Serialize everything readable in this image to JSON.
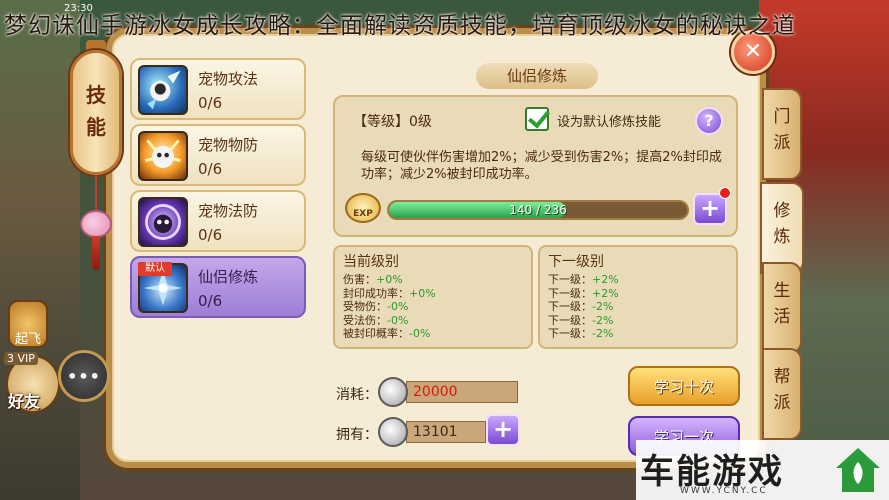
{
  "article_title": "梦幻诛仙手游冰女成长攻略：全面解读资质技能，培育顶级冰女的秘诀之道",
  "clock": "23:30",
  "lantern": {
    "label": "技能"
  },
  "hud": {
    "fly_label": "起飞",
    "friend_label": "好友",
    "vip_label": "3 VIP",
    "chat_icon": "chat-bubble-icon"
  },
  "panel": {
    "title": "仙侣修炼",
    "close_icon": "close-icon"
  },
  "skills": [
    {
      "name": "宠物攻法",
      "progress": "0/6",
      "icon": "pet-attack-icon",
      "selected": false
    },
    {
      "name": "宠物物防",
      "progress": "0/6",
      "icon": "pet-defense-icon",
      "selected": false
    },
    {
      "name": "宠物法防",
      "progress": "0/6",
      "icon": "pet-magic-defense-icon",
      "selected": false
    },
    {
      "name": "仙侣修炼",
      "progress": "0/6",
      "icon": "partner-cultivation-icon",
      "selected": true,
      "tag": "默认"
    }
  ],
  "level": {
    "label": "【等级】0级",
    "default_checkbox_label": "设为默认修炼技能",
    "default_checked": true,
    "description": "每级可使伙伴伤害增加2%；减少受到伤害2%；提高2%封印成功率；减少2%被封印成功率。",
    "exp_badge": "EXP",
    "exp_current": 140,
    "exp_max": 236,
    "exp_text": "140 / 236"
  },
  "current_level": {
    "title": "当前级别",
    "rows": [
      {
        "label": "伤害：",
        "value": "+0%"
      },
      {
        "label": "封印成功率：",
        "value": "+0%"
      },
      {
        "label": "受物伤：",
        "value": "-0%"
      },
      {
        "label": "受法伤：",
        "value": "-0%"
      },
      {
        "label": "被封印概率：",
        "value": "-0%"
      }
    ]
  },
  "next_level": {
    "title": "下一级别",
    "rows": [
      {
        "label": "下一级：",
        "value": "+2%"
      },
      {
        "label": "下一级：",
        "value": "+2%"
      },
      {
        "label": "下一级：",
        "value": "-2%"
      },
      {
        "label": "下一级：",
        "value": "-2%"
      },
      {
        "label": "下一级：",
        "value": "-2%"
      }
    ]
  },
  "cost": {
    "label": "消耗：",
    "value": "20000"
  },
  "owned": {
    "label": "拥有：",
    "value": "13101"
  },
  "buttons": {
    "learn_ten": "学习十次",
    "learn_one": "学习一次"
  },
  "side_tabs": [
    {
      "label": "门派",
      "active": false
    },
    {
      "label": "修炼",
      "active": true
    },
    {
      "label": "生活",
      "active": false
    },
    {
      "label": "帮派",
      "active": false
    }
  ],
  "watermark": {
    "text": "车能游戏",
    "url": "WWW.YCNY.CC"
  },
  "colors": {
    "panel_bg": "#f6ecd6",
    "accent_purple": "#9c7fd6",
    "exp_green": "#2aa04a",
    "cost_red": "#d81a0a"
  }
}
